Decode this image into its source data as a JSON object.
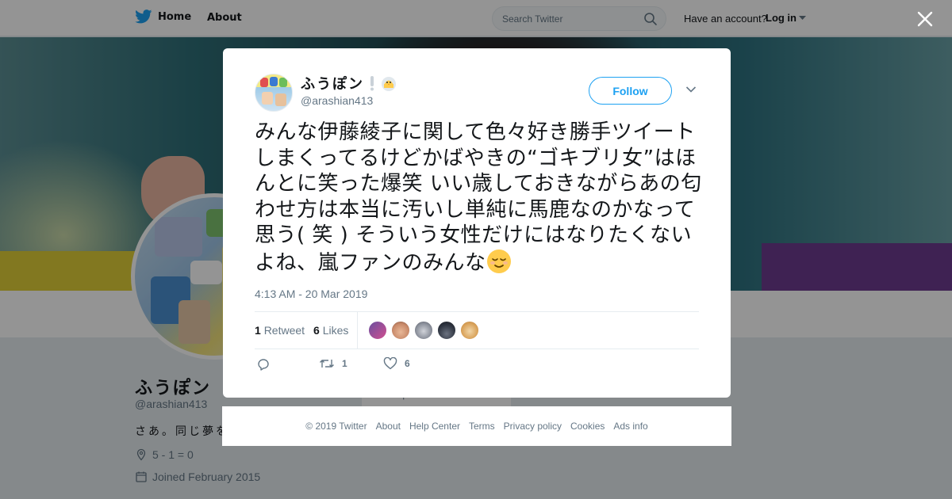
{
  "nav": {
    "home_label": "Home",
    "about_label": "About",
    "search_placeholder": "Search Twitter",
    "have_account": "Have an account?",
    "login_label": "Log in"
  },
  "profile": {
    "name": "ふうぽン",
    "handle": "@arashian413",
    "bio": "さあ。同じ夢を",
    "location": "5 - 1 = 0",
    "joined": "Joined February 2015",
    "footer_peek": "Help Center   Terms"
  },
  "tweet": {
    "author_name": "ふうぽン",
    "author_name_suffix_icons": [
      "exclamation-icon",
      "chick-icon"
    ],
    "author_handle": "@arashian413",
    "follow_label": "Follow",
    "text": "みんな伊藤綾子に関して色々好き勝手ツイートしまくってるけどかばやきの“ゴキブリ女”はほんとに笑った爆笑 いい歳しておきながらあの匂わせ方は本当に汚いし単純に馬鹿なのかなって思う( 笑 ) そういう女性だけにはなりたくないよね、嵐ファンのみんな",
    "trailing_emoji": "relieved-face-icon",
    "timestamp": "4:13 AM - 20 Mar 2019",
    "retweet_count": "1",
    "retweet_label": "Retweet",
    "like_count": "6",
    "like_label": "Likes",
    "liker_colors": [
      "#6b4fa0",
      "#c98a6a",
      "#8a8f9a",
      "#2e3440",
      "#d9a25a"
    ],
    "action_retweet_count": "1",
    "action_like_count": "6"
  },
  "footer": {
    "links": [
      "© 2019 Twitter",
      "About",
      "Help Center",
      "Terms",
      "Privacy policy",
      "Cookies",
      "Ads info"
    ]
  },
  "colors": {
    "accent": "#1da1f2",
    "secondary_text": "#657786",
    "primary_text": "#14171a"
  }
}
